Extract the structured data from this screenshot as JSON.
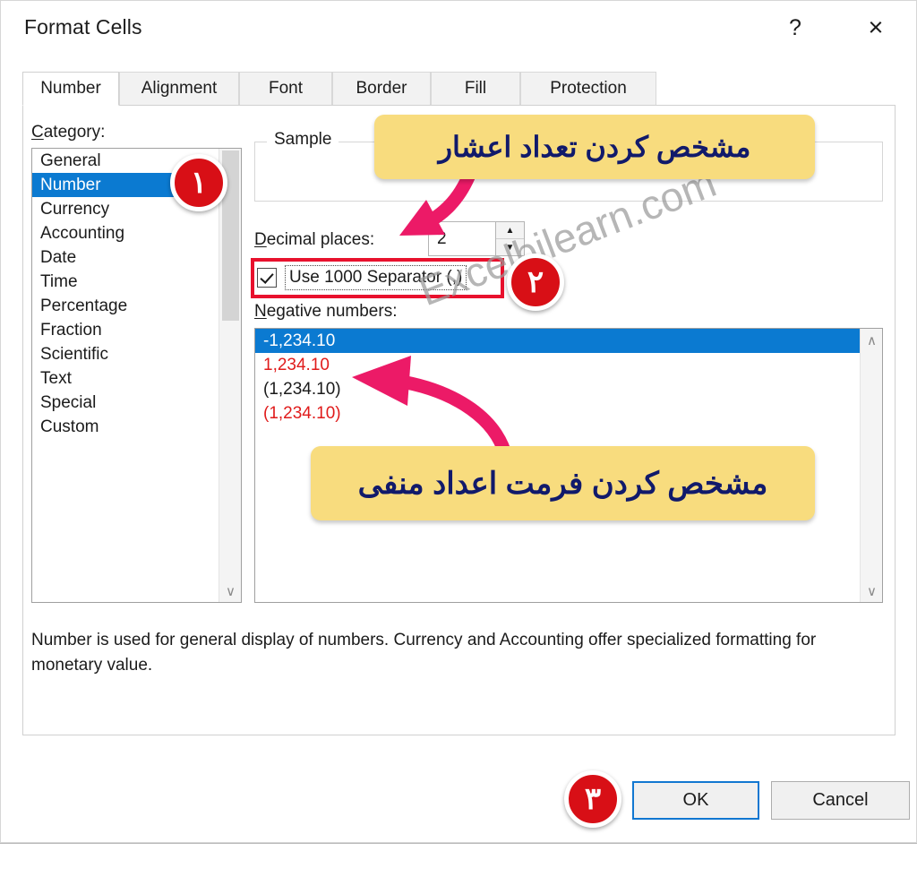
{
  "window": {
    "title": "Format Cells",
    "help_label": "?",
    "close_label": "×"
  },
  "tabs": [
    {
      "label": "Number",
      "active": true
    },
    {
      "label": "Alignment",
      "active": false
    },
    {
      "label": "Font",
      "active": false
    },
    {
      "label": "Border",
      "active": false
    },
    {
      "label": "Fill",
      "active": false
    },
    {
      "label": "Protection",
      "active": false
    }
  ],
  "category": {
    "label": "Category:",
    "accelerator": "C",
    "items": [
      {
        "label": "General",
        "selected": false
      },
      {
        "label": "Number",
        "selected": true
      },
      {
        "label": "Currency",
        "selected": false
      },
      {
        "label": "Accounting",
        "selected": false
      },
      {
        "label": "Date",
        "selected": false
      },
      {
        "label": "Time",
        "selected": false
      },
      {
        "label": "Percentage",
        "selected": false
      },
      {
        "label": "Fraction",
        "selected": false
      },
      {
        "label": "Scientific",
        "selected": false
      },
      {
        "label": "Text",
        "selected": false
      },
      {
        "label": "Special",
        "selected": false
      },
      {
        "label": "Custom",
        "selected": false
      }
    ]
  },
  "sample": {
    "legend": "Sample",
    "value": ""
  },
  "decimal_places": {
    "label": "Decimal places:",
    "accelerator": "D",
    "value": "2",
    "spin_up": "▲",
    "spin_down": "▼"
  },
  "thousand_separator": {
    "label": "Use 1000 Separator (,)",
    "accelerator": "U",
    "checked": true
  },
  "negative_numbers": {
    "label": "Negative numbers:",
    "accelerator": "N",
    "items": [
      {
        "text": "-1,234.10",
        "color": "#ffffff",
        "selected": true
      },
      {
        "text": "1,234.10",
        "color": "#e01b1b",
        "selected": false
      },
      {
        "text": "(1,234.10)",
        "color": "#1b1b1b",
        "selected": false
      },
      {
        "text": "(1,234.10)",
        "color": "#e01b1b",
        "selected": false
      }
    ]
  },
  "description": "Number is used for general display of numbers.  Currency and Accounting offer specialized formatting for monetary value.",
  "footer": {
    "ok_label": "OK",
    "cancel_label": "Cancel"
  },
  "annotations": {
    "callout_decimals": "مشخص کردن تعداد اعشار",
    "callout_negatives": "مشخص کردن فرمت اعداد منفی",
    "badge_1": "۱",
    "badge_2": "۲",
    "badge_3": "۳",
    "watermark": "Excelbilearn.com",
    "highlight_color": "#e8112d",
    "arrow_color": "#ec1a67",
    "callout_bg": "#f8dc7e",
    "callout_text_color": "#111a6b",
    "badge_color": "#d80f16"
  },
  "scrollbars": {
    "up_arrow": "∧",
    "down_arrow": "∨"
  }
}
